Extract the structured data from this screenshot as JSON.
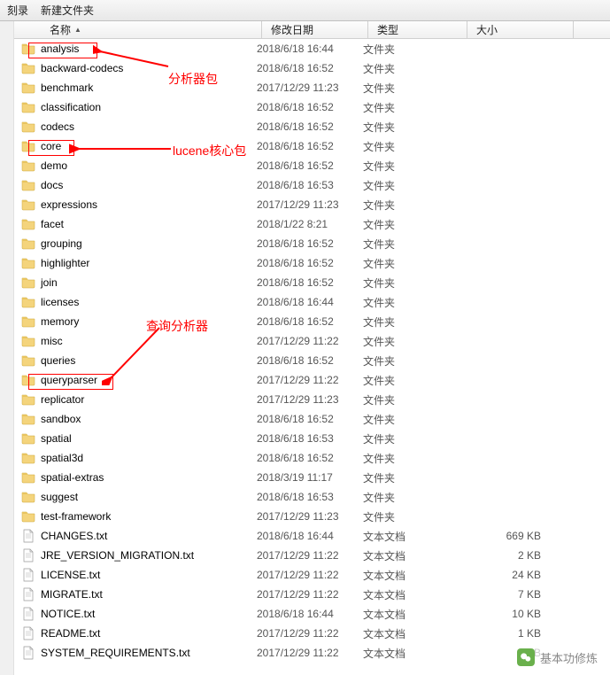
{
  "toolbar": {
    "burn": "刻录",
    "new_folder": "新建文件夹"
  },
  "headers": {
    "name": "名称",
    "date": "修改日期",
    "type": "类型",
    "size": "大小"
  },
  "files": [
    {
      "name": "analysis",
      "date": "2018/6/18 16:44",
      "type": "文件夹",
      "size": "",
      "icon": "folder"
    },
    {
      "name": "backward-codecs",
      "date": "2018/6/18 16:52",
      "type": "文件夹",
      "size": "",
      "icon": "folder"
    },
    {
      "name": "benchmark",
      "date": "2017/12/29 11:23",
      "type": "文件夹",
      "size": "",
      "icon": "folder"
    },
    {
      "name": "classification",
      "date": "2018/6/18 16:52",
      "type": "文件夹",
      "size": "",
      "icon": "folder"
    },
    {
      "name": "codecs",
      "date": "2018/6/18 16:52",
      "type": "文件夹",
      "size": "",
      "icon": "folder"
    },
    {
      "name": "core",
      "date": "2018/6/18 16:52",
      "type": "文件夹",
      "size": "",
      "icon": "folder"
    },
    {
      "name": "demo",
      "date": "2018/6/18 16:52",
      "type": "文件夹",
      "size": "",
      "icon": "folder"
    },
    {
      "name": "docs",
      "date": "2018/6/18 16:53",
      "type": "文件夹",
      "size": "",
      "icon": "folder"
    },
    {
      "name": "expressions",
      "date": "2017/12/29 11:23",
      "type": "文件夹",
      "size": "",
      "icon": "folder"
    },
    {
      "name": "facet",
      "date": "2018/1/22 8:21",
      "type": "文件夹",
      "size": "",
      "icon": "folder"
    },
    {
      "name": "grouping",
      "date": "2018/6/18 16:52",
      "type": "文件夹",
      "size": "",
      "icon": "folder"
    },
    {
      "name": "highlighter",
      "date": "2018/6/18 16:52",
      "type": "文件夹",
      "size": "",
      "icon": "folder"
    },
    {
      "name": "join",
      "date": "2018/6/18 16:52",
      "type": "文件夹",
      "size": "",
      "icon": "folder"
    },
    {
      "name": "licenses",
      "date": "2018/6/18 16:44",
      "type": "文件夹",
      "size": "",
      "icon": "folder"
    },
    {
      "name": "memory",
      "date": "2018/6/18 16:52",
      "type": "文件夹",
      "size": "",
      "icon": "folder"
    },
    {
      "name": "misc",
      "date": "2017/12/29 11:22",
      "type": "文件夹",
      "size": "",
      "icon": "folder"
    },
    {
      "name": "queries",
      "date": "2018/6/18 16:52",
      "type": "文件夹",
      "size": "",
      "icon": "folder"
    },
    {
      "name": "queryparser",
      "date": "2017/12/29 11:22",
      "type": "文件夹",
      "size": "",
      "icon": "folder"
    },
    {
      "name": "replicator",
      "date": "2017/12/29 11:23",
      "type": "文件夹",
      "size": "",
      "icon": "folder"
    },
    {
      "name": "sandbox",
      "date": "2018/6/18 16:52",
      "type": "文件夹",
      "size": "",
      "icon": "folder"
    },
    {
      "name": "spatial",
      "date": "2018/6/18 16:53",
      "type": "文件夹",
      "size": "",
      "icon": "folder"
    },
    {
      "name": "spatial3d",
      "date": "2018/6/18 16:52",
      "type": "文件夹",
      "size": "",
      "icon": "folder"
    },
    {
      "name": "spatial-extras",
      "date": "2018/3/19 11:17",
      "type": "文件夹",
      "size": "",
      "icon": "folder"
    },
    {
      "name": "suggest",
      "date": "2018/6/18 16:53",
      "type": "文件夹",
      "size": "",
      "icon": "folder"
    },
    {
      "name": "test-framework",
      "date": "2017/12/29 11:23",
      "type": "文件夹",
      "size": "",
      "icon": "folder"
    },
    {
      "name": "CHANGES.txt",
      "date": "2018/6/18 16:44",
      "type": "文本文档",
      "size": "669 KB",
      "icon": "file"
    },
    {
      "name": "JRE_VERSION_MIGRATION.txt",
      "date": "2017/12/29 11:22",
      "type": "文本文档",
      "size": "2 KB",
      "icon": "file"
    },
    {
      "name": "LICENSE.txt",
      "date": "2017/12/29 11:22",
      "type": "文本文档",
      "size": "24 KB",
      "icon": "file"
    },
    {
      "name": "MIGRATE.txt",
      "date": "2017/12/29 11:22",
      "type": "文本文档",
      "size": "7 KB",
      "icon": "file"
    },
    {
      "name": "NOTICE.txt",
      "date": "2018/6/18 16:44",
      "type": "文本文档",
      "size": "10 KB",
      "icon": "file"
    },
    {
      "name": "README.txt",
      "date": "2017/12/29 11:22",
      "type": "文本文档",
      "size": "1 KB",
      "icon": "file"
    },
    {
      "name": "SYSTEM_REQUIREMENTS.txt",
      "date": "2017/12/29 11:22",
      "type": "文本文档",
      "size": "KB",
      "icon": "file"
    }
  ],
  "annotations": {
    "analysis": "分析器包",
    "core": "lucene核心包",
    "queryparser": "查询分析器"
  },
  "footer": {
    "brand": "基本功修炼"
  }
}
